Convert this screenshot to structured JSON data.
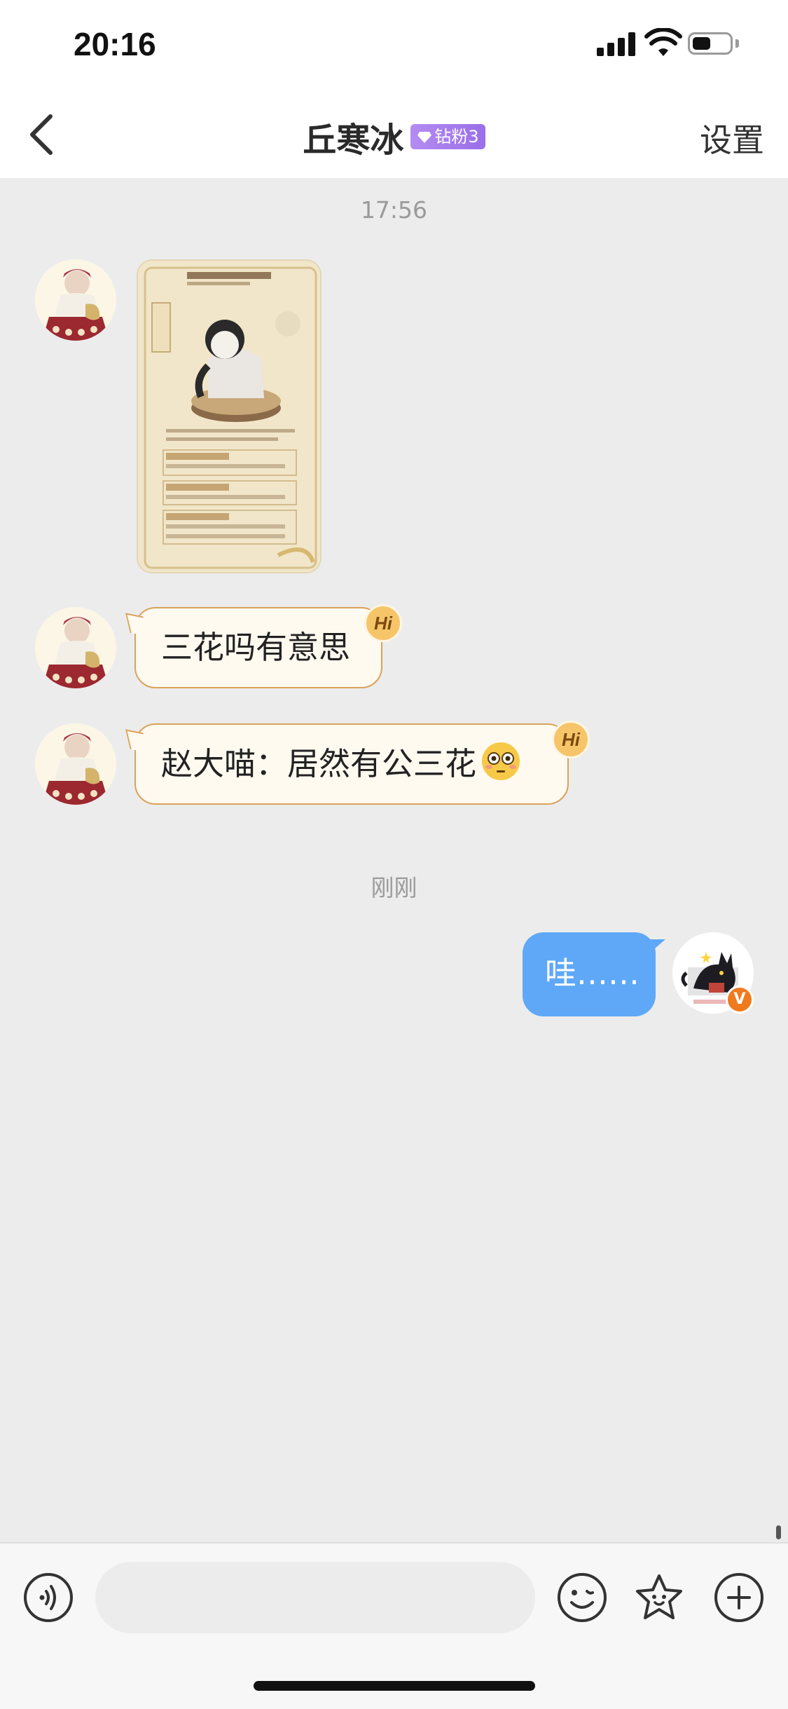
{
  "status_bar": {
    "time": "20:16",
    "battery_level": 0.5
  },
  "header": {
    "title": "丘寒冰",
    "fan_badge": "钻粉3",
    "settings_label": "设置"
  },
  "messages": {
    "timestamp_1": "17:56",
    "text_1": "三花吗有意思",
    "text_2": "赵大喵：居然有公三花",
    "hi_label": "Hi",
    "timestamp_2": "刚刚",
    "my_text": "哇……"
  },
  "input": {
    "placeholder": ""
  },
  "colors": {
    "background": "#ececec",
    "other_bubble": "#fffaf0",
    "other_bubble_border": "#d9a25a",
    "my_bubble": "#5ea8f7",
    "fan_badge": "#a27af0",
    "verify_badge": "#f07a1e"
  },
  "icons": [
    "back-chevron-icon",
    "diamond-icon",
    "voice-icon",
    "emoji-face-icon",
    "star-sticker-icon",
    "plus-circle-icon",
    "verified-badge-icon",
    "flushed-face-emoji"
  ]
}
